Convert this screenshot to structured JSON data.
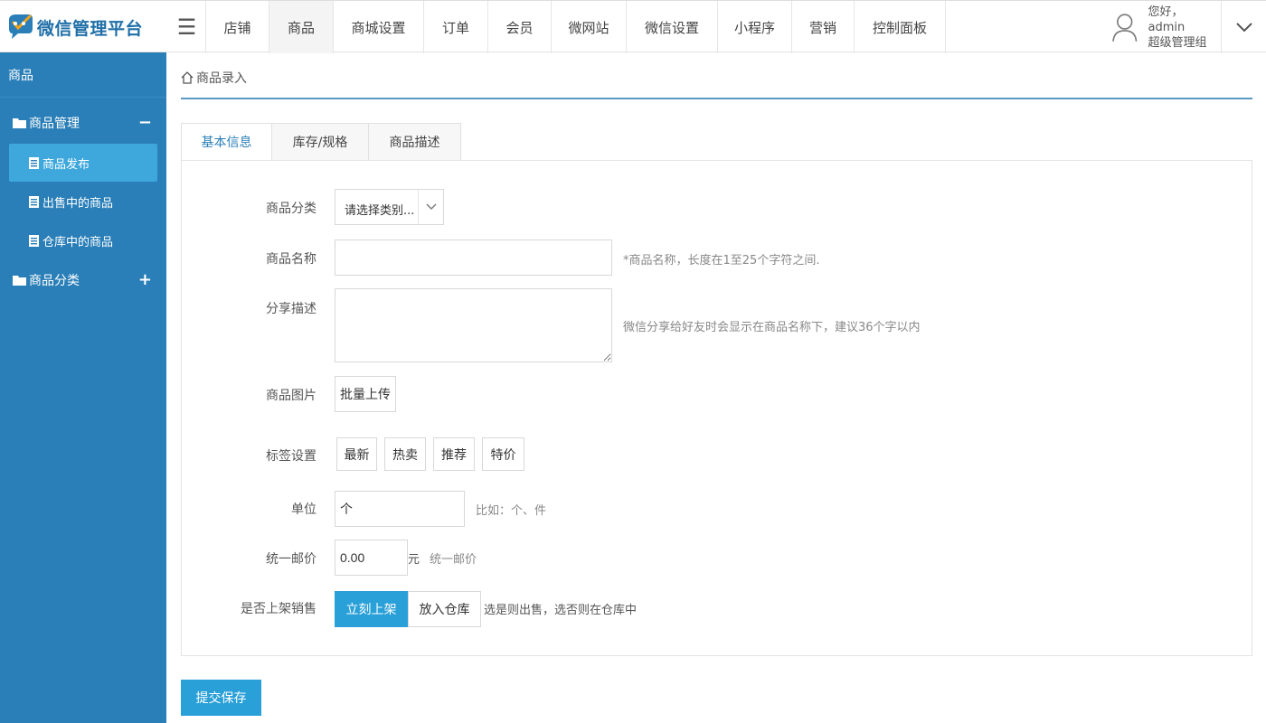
{
  "app": {
    "title": "微信管理平台"
  },
  "header": {
    "menu_icon": "hamburger-icon",
    "nav": [
      "店铺",
      "商品",
      "商城设置",
      "订单",
      "会员",
      "微网站",
      "微信设置",
      "小程序",
      "营销",
      "控制面板"
    ],
    "active_nav_index": 1,
    "user_greeting": "您好，admin",
    "user_role": "超级管理组"
  },
  "sidebar": {
    "title": "商品",
    "groups": [
      {
        "label": "商品管理",
        "sign": "−",
        "items": [
          "商品发布",
          "出售中的商品",
          "仓库中的商品"
        ],
        "active_item": 0
      },
      {
        "label": "商品分类",
        "sign": "+"
      }
    ]
  },
  "breadcrumb": {
    "label": "商品录入"
  },
  "tabs": [
    "基本信息",
    "库存/规格",
    "商品描述"
  ],
  "active_tab": 0,
  "form": {
    "category": {
      "label": "商品分类",
      "value": "请选择类别..."
    },
    "name": {
      "label": "商品名称",
      "value": "",
      "hint": "*商品名称，长度在1至25个字符之间."
    },
    "share": {
      "label": "分享描述",
      "value": "",
      "hint": "微信分享给好友时会显示在商品名称下，建议36个字以内"
    },
    "images": {
      "label": "商品图片",
      "button": "批量上传"
    },
    "tags": {
      "label": "标签设置",
      "options": [
        "最新",
        "热卖",
        "推荐",
        "特价"
      ]
    },
    "unit": {
      "label": "单位",
      "value": "个",
      "hint": "比如：个、件"
    },
    "price": {
      "label": "统一邮价",
      "value": "0.00",
      "suffix": "元",
      "hint": "统一邮价"
    },
    "onsale": {
      "label": "是否上架销售",
      "options": [
        "立刻上架",
        "放入仓库"
      ],
      "selected": 0,
      "hint": "选是则出售，选否则在仓库中"
    }
  },
  "submit": {
    "label": "提交保存"
  },
  "colors": {
    "sidebar_bg": "#2a7fb8",
    "sidebar_active": "#3ea8dc",
    "primary_button": "#2aa0d8",
    "logo_text": "#1f6fa8"
  }
}
